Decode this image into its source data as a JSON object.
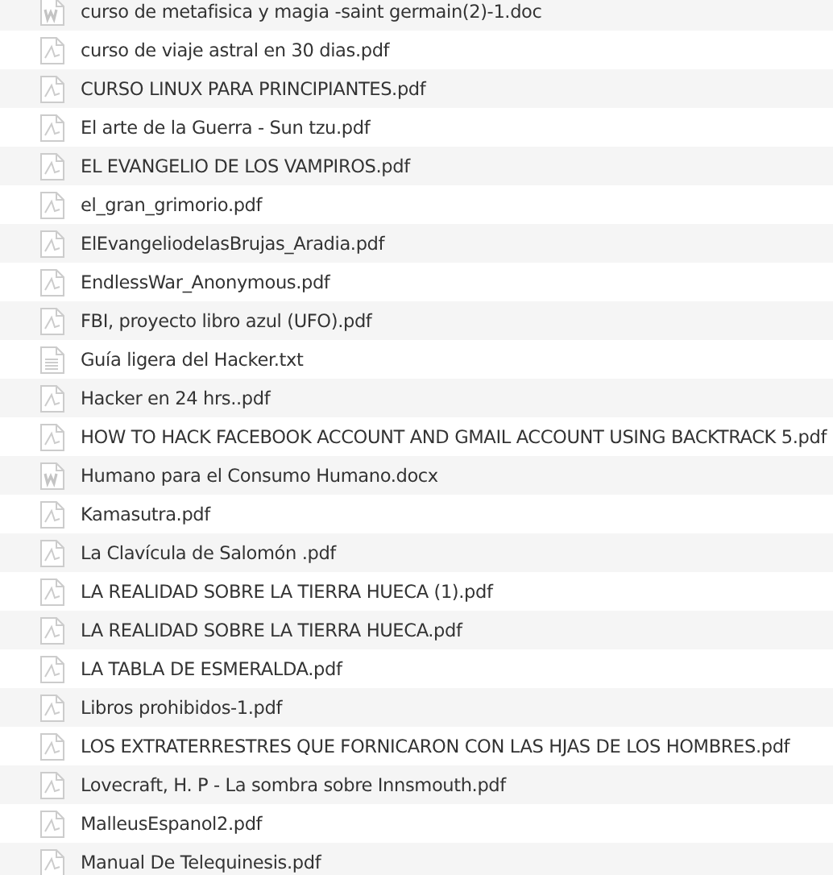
{
  "files": [
    {
      "name": "curso de metafisica y magia -saint germain(2)-1.doc",
      "kind": "word"
    },
    {
      "name": "curso de viaje astral en 30 dias.pdf",
      "kind": "pdf"
    },
    {
      "name": "CURSO LINUX PARA PRINCIPIANTES.pdf",
      "kind": "pdf"
    },
    {
      "name": "El arte de la Guerra - Sun tzu.pdf",
      "kind": "pdf"
    },
    {
      "name": "EL EVANGELIO DE LOS VAMPIROS.pdf",
      "kind": "pdf"
    },
    {
      "name": "el_gran_grimorio.pdf",
      "kind": "pdf"
    },
    {
      "name": "ElEvangeliodelasBrujas_Aradia.pdf",
      "kind": "pdf"
    },
    {
      "name": "EndlessWar_Anonymous.pdf",
      "kind": "pdf"
    },
    {
      "name": "FBI, proyecto libro azul (UFO).pdf",
      "kind": "pdf"
    },
    {
      "name": "Guía ligera del Hacker.txt",
      "kind": "text"
    },
    {
      "name": "Hacker en 24 hrs..pdf",
      "kind": "pdf"
    },
    {
      "name": "HOW TO HACK FACEBOOK ACCOUNT AND GMAIL ACCOUNT USING BACKTRACK 5.pdf",
      "kind": "pdf"
    },
    {
      "name": "Humano para el Consumo Humano.docx",
      "kind": "word"
    },
    {
      "name": "Kamasutra.pdf",
      "kind": "pdf"
    },
    {
      "name": "La Clavícula de Salomón .pdf",
      "kind": "pdf"
    },
    {
      "name": "LA REALIDAD SOBRE LA TIERRA HUECA (1).pdf",
      "kind": "pdf"
    },
    {
      "name": "LA REALIDAD SOBRE LA TIERRA HUECA.pdf",
      "kind": "pdf"
    },
    {
      "name": "LA TABLA DE ESMERALDA.pdf",
      "kind": "pdf"
    },
    {
      "name": "Libros prohibidos-1.pdf",
      "kind": "pdf"
    },
    {
      "name": "LOS EXTRATERRESTRES QUE FORNICARON CON LAS HJAS DE LOS HOMBRES.pdf",
      "kind": "pdf"
    },
    {
      "name": "Lovecraft, H. P - La sombra sobre Innsmouth.pdf",
      "kind": "pdf"
    },
    {
      "name": "MalleusEspanol2.pdf",
      "kind": "pdf"
    },
    {
      "name": "Manual De Telequinesis.pdf",
      "kind": "pdf"
    }
  ]
}
